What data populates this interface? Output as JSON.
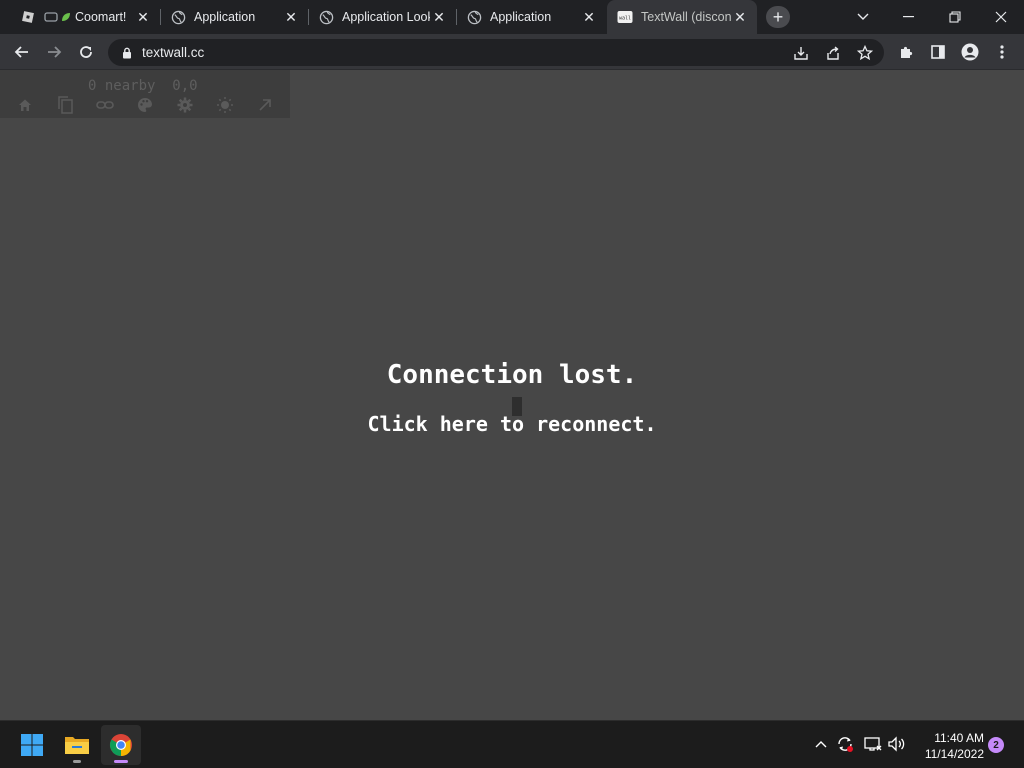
{
  "browser": {
    "tabs": [
      {
        "title": "Coomart!",
        "icon": "roblox-icon",
        "active": false
      },
      {
        "title": "Application",
        "icon": "globe-icon",
        "active": false
      },
      {
        "title": "Application Look",
        "icon": "globe-icon",
        "active": false
      },
      {
        "title": "Application",
        "icon": "globe-icon",
        "active": false
      },
      {
        "title": "TextWall (disconnected)",
        "icon": "textwall-icon",
        "active": true
      }
    ],
    "new_tab_label": "+",
    "address": "textwall.cc"
  },
  "page": {
    "hud_stats": "0 nearby  0,0",
    "hud_icons": [
      "home-icon",
      "copy-icon",
      "link-icon",
      "palette-icon",
      "settings-icon",
      "brightness-icon",
      "teleport-arrow-icon"
    ],
    "status_title": "Connection lost.",
    "reconnect_label": "Click here to reconnect."
  },
  "taskbar": {
    "apps": [
      "windows-start-icon",
      "file-explorer-icon",
      "chrome-icon"
    ],
    "time": "11:40 AM",
    "date": "11/14/2022",
    "notification_count": "2"
  },
  "colors": {
    "page_background": "#474747",
    "tab_strip": "#202124",
    "toolbar": "#35363a",
    "notification_badge": "#c58af9"
  }
}
